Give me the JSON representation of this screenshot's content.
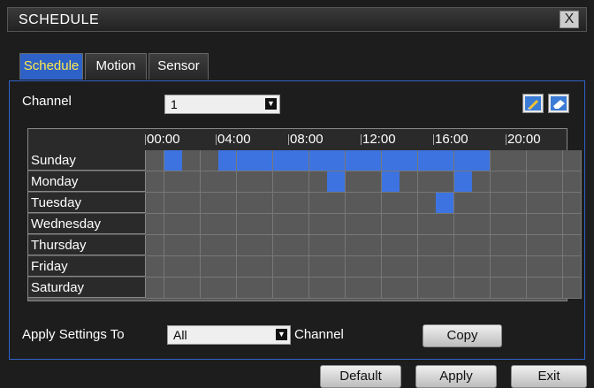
{
  "window": {
    "title": "SCHEDULE",
    "close_label": "X"
  },
  "tabs": [
    {
      "label": "Schedule",
      "active": true
    },
    {
      "label": "Motion",
      "active": false
    },
    {
      "label": "Sensor",
      "active": false
    }
  ],
  "channel": {
    "label": "Channel",
    "value": "1"
  },
  "grid": {
    "hour_labels": [
      "00:00",
      "04:00",
      "08:00",
      "12:00",
      "16:00",
      "20:00"
    ],
    "days": [
      {
        "label": "Sunday",
        "on_hours": [
          1,
          4,
          5,
          6,
          7,
          8,
          9,
          10,
          11,
          12,
          13,
          14,
          15,
          16,
          17,
          18
        ]
      },
      {
        "label": "Monday",
        "on_hours": [
          10,
          13,
          17
        ]
      },
      {
        "label": "Tuesday",
        "on_hours": [
          16
        ]
      },
      {
        "label": "Wednesday",
        "on_hours": []
      },
      {
        "label": "Thursday",
        "on_hours": []
      },
      {
        "label": "Friday",
        "on_hours": []
      },
      {
        "label": "Saturday",
        "on_hours": []
      }
    ]
  },
  "apply": {
    "label": "Apply Settings To",
    "value": "All",
    "suffix": "Channel",
    "copy_label": "Copy"
  },
  "footer": {
    "default_label": "Default",
    "apply_label": "Apply",
    "exit_label": "Exit"
  },
  "colors": {
    "accent": "#2f62c7",
    "active_cell": "#3d73e0",
    "active_tab_text": "#ffe84a"
  }
}
